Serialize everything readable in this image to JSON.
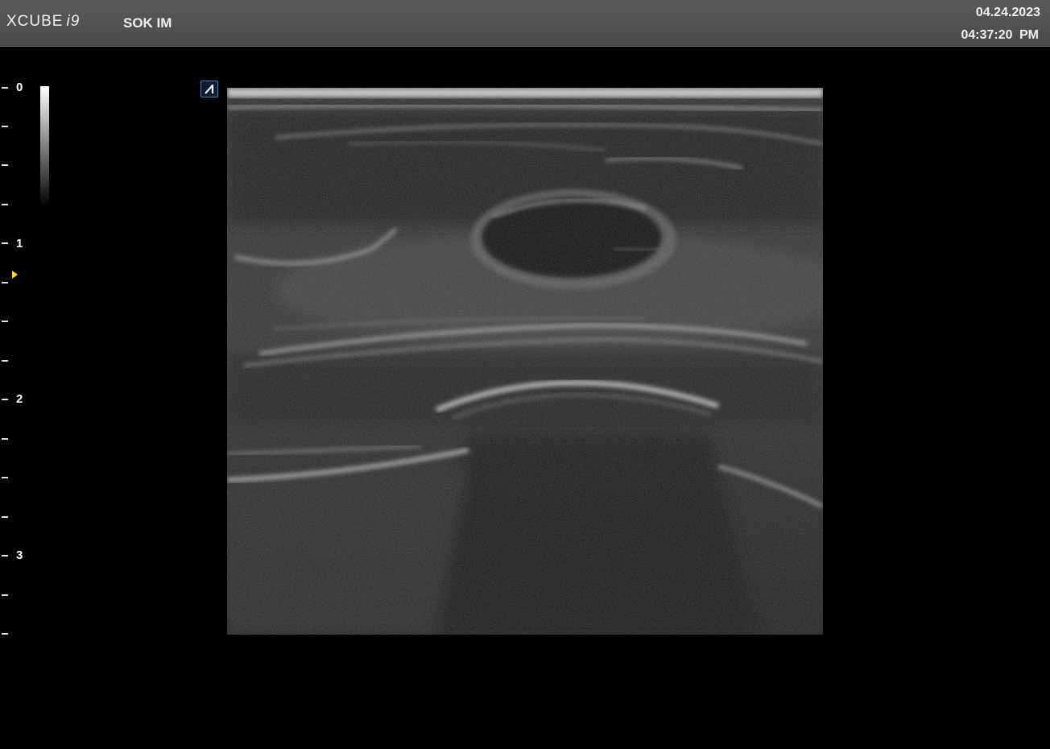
{
  "header": {
    "brand_name": "XCUBE",
    "brand_model": "i9",
    "mode_label": "SOK IM",
    "date": "04.24.2023",
    "time": "04:37:20  PM"
  },
  "depth_scale": {
    "labels": [
      "0",
      "1",
      "2",
      "3"
    ],
    "marker_color": "#ffe000"
  },
  "icons": {
    "orientation": "orientation-marker-icon",
    "focus": "focus-marker-icon"
  },
  "colors": {
    "header_background": "#4f4f4f",
    "orientation_border": "#3f7fc6"
  }
}
